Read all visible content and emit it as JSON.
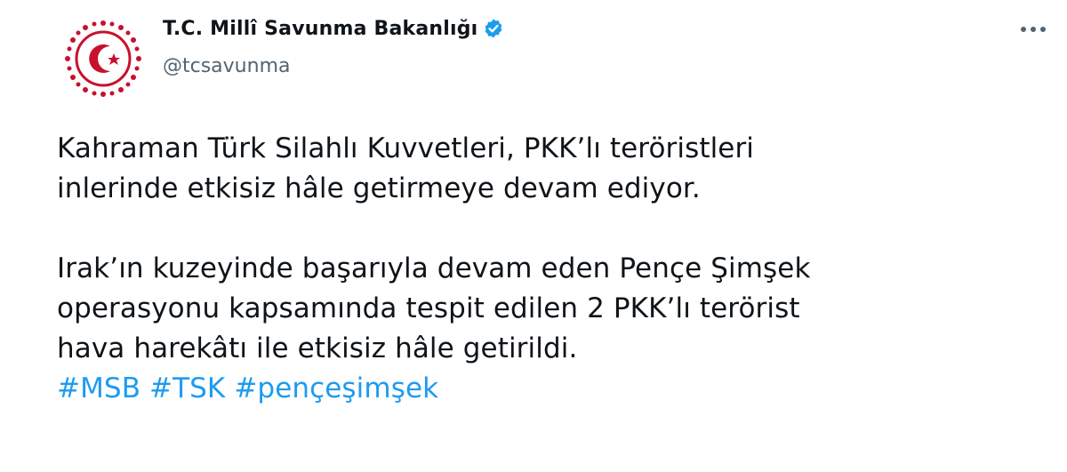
{
  "account": {
    "display_name": "T.C. Millî Savunma Bakanlığı",
    "handle": "@tcsavunma",
    "verified": true,
    "verified_icon": "verified-badge-icon",
    "avatar_icon": "ministry-emblem-logo",
    "brand_color": "#c8102e"
  },
  "menu": {
    "icon": "more-horizontal-icon"
  },
  "tweet": {
    "paragraph_1": [
      "Kahraman Türk Silahlı Kuvvetleri, PKK’lı teröristleri",
      "inlerinde etkisiz hâle getirmeye devam ediyor."
    ],
    "paragraph_2": [
      "Irak’ın kuzeyinde başarıyla devam eden Pençe Şimşek",
      "operasyonu kapsamında tespit edilen 2 PKK’lı terörist",
      "hava harekâtı ile etkisiz hâle getirildi."
    ],
    "hashtags": [
      "#MSB",
      "#TSK",
      "#pençeşimşek"
    ],
    "link_color": "#1d9bf0"
  }
}
